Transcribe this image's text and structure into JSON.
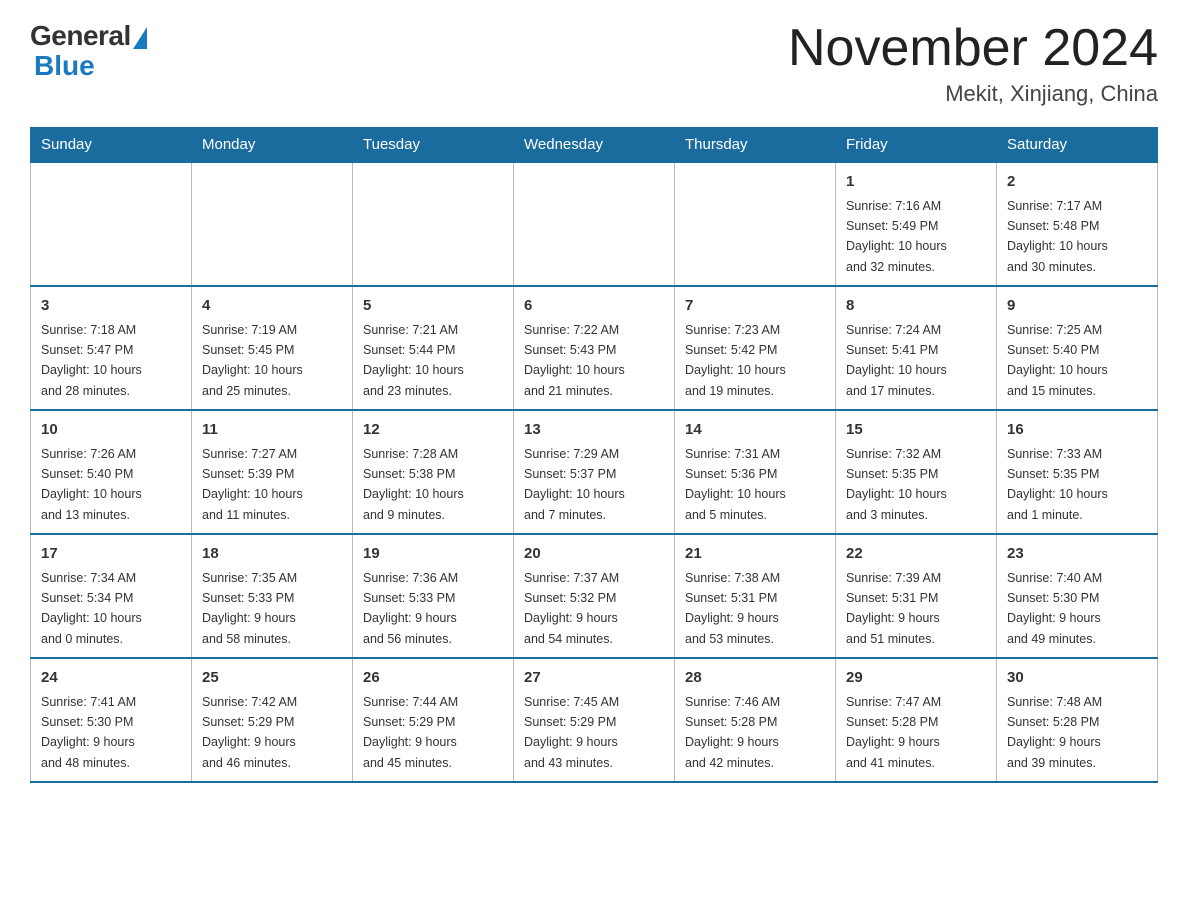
{
  "header": {
    "logo": {
      "general": "General",
      "blue": "Blue"
    },
    "title": "November 2024",
    "location": "Mekit, Xinjiang, China"
  },
  "weekdays": [
    "Sunday",
    "Monday",
    "Tuesday",
    "Wednesday",
    "Thursday",
    "Friday",
    "Saturday"
  ],
  "weeks": [
    [
      {
        "day": "",
        "info": ""
      },
      {
        "day": "",
        "info": ""
      },
      {
        "day": "",
        "info": ""
      },
      {
        "day": "",
        "info": ""
      },
      {
        "day": "",
        "info": ""
      },
      {
        "day": "1",
        "info": "Sunrise: 7:16 AM\nSunset: 5:49 PM\nDaylight: 10 hours\nand 32 minutes."
      },
      {
        "day": "2",
        "info": "Sunrise: 7:17 AM\nSunset: 5:48 PM\nDaylight: 10 hours\nand 30 minutes."
      }
    ],
    [
      {
        "day": "3",
        "info": "Sunrise: 7:18 AM\nSunset: 5:47 PM\nDaylight: 10 hours\nand 28 minutes."
      },
      {
        "day": "4",
        "info": "Sunrise: 7:19 AM\nSunset: 5:45 PM\nDaylight: 10 hours\nand 25 minutes."
      },
      {
        "day": "5",
        "info": "Sunrise: 7:21 AM\nSunset: 5:44 PM\nDaylight: 10 hours\nand 23 minutes."
      },
      {
        "day": "6",
        "info": "Sunrise: 7:22 AM\nSunset: 5:43 PM\nDaylight: 10 hours\nand 21 minutes."
      },
      {
        "day": "7",
        "info": "Sunrise: 7:23 AM\nSunset: 5:42 PM\nDaylight: 10 hours\nand 19 minutes."
      },
      {
        "day": "8",
        "info": "Sunrise: 7:24 AM\nSunset: 5:41 PM\nDaylight: 10 hours\nand 17 minutes."
      },
      {
        "day": "9",
        "info": "Sunrise: 7:25 AM\nSunset: 5:40 PM\nDaylight: 10 hours\nand 15 minutes."
      }
    ],
    [
      {
        "day": "10",
        "info": "Sunrise: 7:26 AM\nSunset: 5:40 PM\nDaylight: 10 hours\nand 13 minutes."
      },
      {
        "day": "11",
        "info": "Sunrise: 7:27 AM\nSunset: 5:39 PM\nDaylight: 10 hours\nand 11 minutes."
      },
      {
        "day": "12",
        "info": "Sunrise: 7:28 AM\nSunset: 5:38 PM\nDaylight: 10 hours\nand 9 minutes."
      },
      {
        "day": "13",
        "info": "Sunrise: 7:29 AM\nSunset: 5:37 PM\nDaylight: 10 hours\nand 7 minutes."
      },
      {
        "day": "14",
        "info": "Sunrise: 7:31 AM\nSunset: 5:36 PM\nDaylight: 10 hours\nand 5 minutes."
      },
      {
        "day": "15",
        "info": "Sunrise: 7:32 AM\nSunset: 5:35 PM\nDaylight: 10 hours\nand 3 minutes."
      },
      {
        "day": "16",
        "info": "Sunrise: 7:33 AM\nSunset: 5:35 PM\nDaylight: 10 hours\nand 1 minute."
      }
    ],
    [
      {
        "day": "17",
        "info": "Sunrise: 7:34 AM\nSunset: 5:34 PM\nDaylight: 10 hours\nand 0 minutes."
      },
      {
        "day": "18",
        "info": "Sunrise: 7:35 AM\nSunset: 5:33 PM\nDaylight: 9 hours\nand 58 minutes."
      },
      {
        "day": "19",
        "info": "Sunrise: 7:36 AM\nSunset: 5:33 PM\nDaylight: 9 hours\nand 56 minutes."
      },
      {
        "day": "20",
        "info": "Sunrise: 7:37 AM\nSunset: 5:32 PM\nDaylight: 9 hours\nand 54 minutes."
      },
      {
        "day": "21",
        "info": "Sunrise: 7:38 AM\nSunset: 5:31 PM\nDaylight: 9 hours\nand 53 minutes."
      },
      {
        "day": "22",
        "info": "Sunrise: 7:39 AM\nSunset: 5:31 PM\nDaylight: 9 hours\nand 51 minutes."
      },
      {
        "day": "23",
        "info": "Sunrise: 7:40 AM\nSunset: 5:30 PM\nDaylight: 9 hours\nand 49 minutes."
      }
    ],
    [
      {
        "day": "24",
        "info": "Sunrise: 7:41 AM\nSunset: 5:30 PM\nDaylight: 9 hours\nand 48 minutes."
      },
      {
        "day": "25",
        "info": "Sunrise: 7:42 AM\nSunset: 5:29 PM\nDaylight: 9 hours\nand 46 minutes."
      },
      {
        "day": "26",
        "info": "Sunrise: 7:44 AM\nSunset: 5:29 PM\nDaylight: 9 hours\nand 45 minutes."
      },
      {
        "day": "27",
        "info": "Sunrise: 7:45 AM\nSunset: 5:29 PM\nDaylight: 9 hours\nand 43 minutes."
      },
      {
        "day": "28",
        "info": "Sunrise: 7:46 AM\nSunset: 5:28 PM\nDaylight: 9 hours\nand 42 minutes."
      },
      {
        "day": "29",
        "info": "Sunrise: 7:47 AM\nSunset: 5:28 PM\nDaylight: 9 hours\nand 41 minutes."
      },
      {
        "day": "30",
        "info": "Sunrise: 7:48 AM\nSunset: 5:28 PM\nDaylight: 9 hours\nand 39 minutes."
      }
    ]
  ]
}
